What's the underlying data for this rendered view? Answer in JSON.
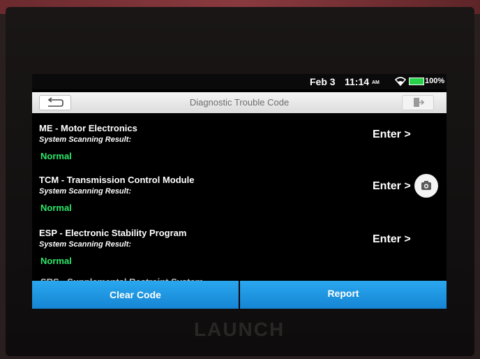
{
  "status": {
    "date": "Feb 3",
    "time": "11:14",
    "ampm": "AM",
    "battery": "100%"
  },
  "header": {
    "title": "Diagnostic Trouble Code"
  },
  "systems": [
    {
      "name": "ME - Motor Electronics",
      "label": "System Scanning Result:",
      "result": "Normal",
      "action": "Enter >"
    },
    {
      "name": "TCM - Transmission Control Module",
      "label": "System Scanning Result:",
      "result": "Normal",
      "action": "Enter >"
    },
    {
      "name": "ESP - Electronic Stability Program",
      "label": "System Scanning Result:",
      "result": "Normal",
      "action": "Enter >"
    }
  ],
  "partial_item": "SRS - Supplemental Restraint System",
  "actions": {
    "clear": "Clear Code",
    "report": "Report"
  },
  "brand": "LAUNCH",
  "colors": {
    "accent": "#1f96e4",
    "normal": "#2ee86a"
  },
  "icons": {
    "back": "back-arrow-icon",
    "exit": "exit-icon",
    "camera": "camera-icon",
    "wifi": "wifi-icon",
    "battery": "battery-icon"
  }
}
